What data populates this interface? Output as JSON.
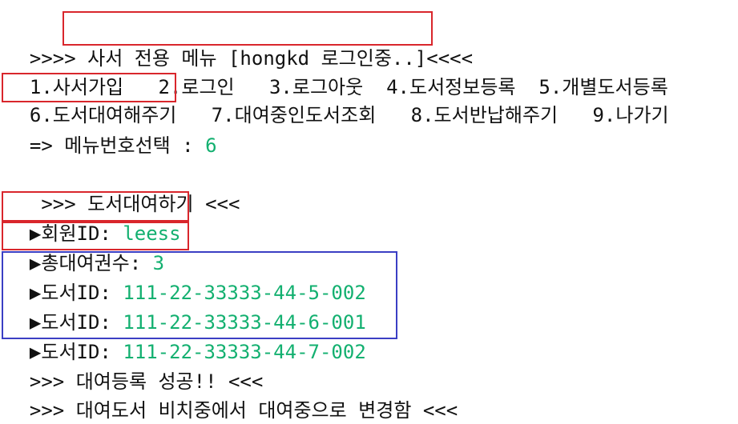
{
  "header": {
    "prefix": ">>>> ",
    "title": "사서 전용 메뉴 [hongkd 로그인중..]",
    "suffix": "<<<<"
  },
  "menu": {
    "items": [
      "1.사서가입",
      "2.로그인",
      "3.로그아웃",
      "4.도서정보등록",
      "5.개별도서등록",
      "6.도서대여해주기",
      "7.대여중인도서조회",
      "8.도서반납해주기",
      "9.나가기"
    ]
  },
  "prompt": {
    "label": "=> 메뉴번호선택 : ",
    "value": "6"
  },
  "section": {
    "title": " >>> 도서대여하기 <<<"
  },
  "fields": {
    "arrow": "▶",
    "member_label": "회원ID: ",
    "member_value": "leess",
    "total_label": "총대여권수: ",
    "total_value": "3",
    "book_label": "도서ID: ",
    "books": [
      "111-22-33333-44-5-002",
      "111-22-33333-44-6-001",
      "111-22-33333-44-7-002"
    ]
  },
  "messages": {
    "success": ">>> 대여등록 성공!! <<<",
    "status": ">>> 대여도서 비치중에서 대여중으로 변경함 <<<"
  },
  "colors": {
    "value_green": "#13b070",
    "highlight_red": "#d9262c",
    "highlight_blue": "#3b3fc4"
  }
}
